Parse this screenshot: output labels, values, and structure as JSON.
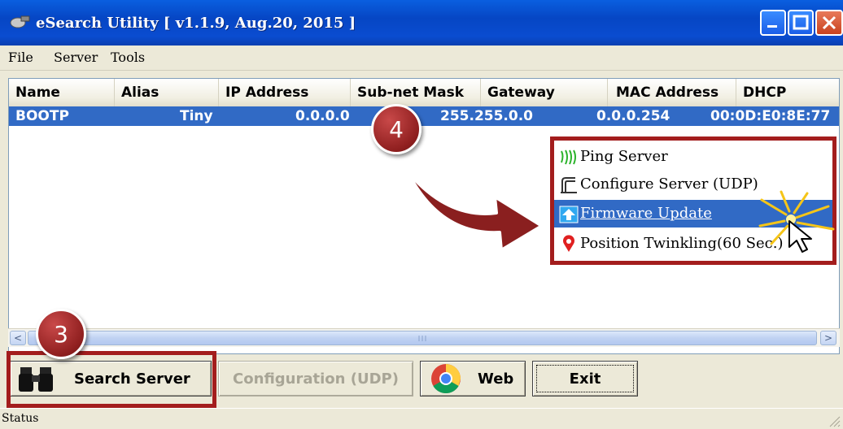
{
  "window": {
    "title": "eSearch Utility [ v1.1.9, Aug.20, 2015 ]"
  },
  "menu": {
    "items": [
      "File",
      "Server",
      "Tools"
    ]
  },
  "table": {
    "columns": [
      "Name",
      "Alias",
      "IP Address",
      "Sub-net Mask",
      "Gateway",
      "MAC Address",
      "DHCP"
    ],
    "rows": [
      {
        "name": "BOOTP",
        "alias": "Tiny",
        "ip": "0.0.0.0",
        "mask": "255.255.0.0",
        "gateway": "0.0.0.254",
        "mac": "00:0D:E0:8E:77"
      }
    ]
  },
  "scrollbar": {
    "left_arrow": "<",
    "right_arrow": ">"
  },
  "buttons": {
    "search": "Search Server",
    "configuration": "Configuration (UDP)",
    "web": "Web",
    "exit": "Exit"
  },
  "context_menu": {
    "items": [
      {
        "label": "Ping Server",
        "icon": "ping-icon"
      },
      {
        "label": "Configure Server (UDP)",
        "icon": "configure-icon"
      },
      {
        "label": "Firmware Update",
        "icon": "upload-arrow-icon"
      },
      {
        "label": "Position Twinkling(60 Sec.)",
        "icon": "location-pin-icon"
      }
    ],
    "selected": "Firmware Update"
  },
  "annotations": {
    "step3": "3",
    "step4": "4"
  },
  "status": {
    "text": "Status"
  },
  "colors": {
    "selection": "#316ac5",
    "annotation": "#a31d1d",
    "titlebar": "#0a4cd0"
  }
}
